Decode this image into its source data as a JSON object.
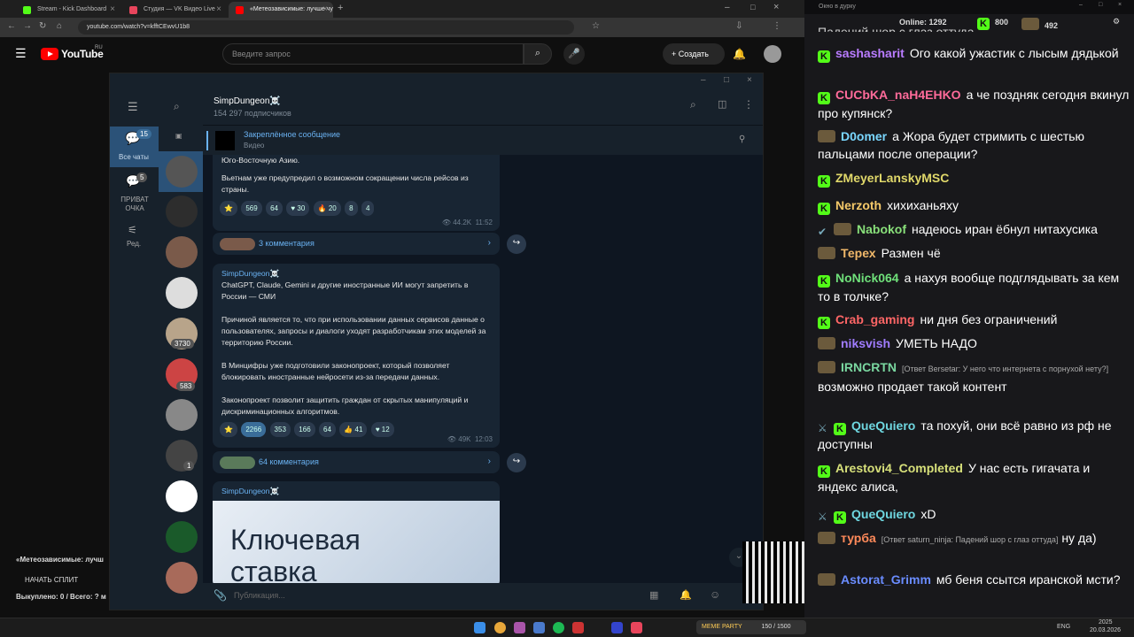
{
  "browser": {
    "tabs": [
      {
        "label": "Stream - Kick Dashboard",
        "color": "#53fc18"
      },
      {
        "label": "Студия — VK Видео Live",
        "color": "#e8455c"
      },
      {
        "label": "«Метеозависимые: лучше чу",
        "color": "#ff0000"
      }
    ],
    "url": "youtube.com/watch?v=kfftCEwvU1b8"
  },
  "youtube": {
    "logo_text": "YouTube",
    "region": "RU",
    "search_placeholder": "Введите запрос",
    "create_label": "Создать",
    "left_text_1": "«Метеозависимые: лучш",
    "left_text_2": "НАЧАТЬ СПЛИТ",
    "left_text_3": "Выкуплено: 0 / Всего: ? м"
  },
  "telegram": {
    "sidebar": {
      "all_chats_label": "Все чаты",
      "all_chats_badge": "15",
      "private_label": "ПРИВАТ ОЧКА",
      "private_badge": "5",
      "edit_label": "Ред."
    },
    "list_badges": [
      "3730",
      "583",
      "1"
    ],
    "channel": {
      "name": "SimpDungeon☠️",
      "subs": "154 297 подписчиков"
    },
    "pinned": {
      "title": "Закреплённое сообщение",
      "subtitle": "Видео"
    },
    "msg1": {
      "text_a": "Юго-Восточную Азию.",
      "text_b": "Вьетнам уже предупредил о возможном сокращении числа рейсов из страны.",
      "reactions": [
        "⭐",
        "569",
        "64",
        "♥ 30",
        "🔥 20",
        "8",
        "4"
      ],
      "views": "44.2K",
      "time": "11:52",
      "comments": "3 комментария"
    },
    "msg2": {
      "author": "SimpDungeon☠️",
      "p1": "ChatGPT, Claude, Gemini и другие иностранные ИИ могут запретить в России — СМИ",
      "p2": "Причиной является то, что при использовании данных сервисов данные о пользователях, запросы и диалоги уходят разработчикам этих моделей за территорию России.",
      "p3": "В Минцифры уже подготовили законопроект, который позволяет блокировать иностранные нейросети из-за передачи данных.",
      "p4": "Законопроект позволит защитить граждан от скрытых манипуляций и дискриминационных алгоритмов.",
      "reactions": [
        "⭐",
        "2266",
        "353",
        "166",
        "64",
        "👍 41",
        "♥ 12"
      ],
      "views": "49K",
      "time": "12:03",
      "comments": "64 комментария"
    },
    "msg3": {
      "author": "SimpDungeon☠️",
      "image_text": "Ключевая ставка"
    },
    "composer_placeholder": "Публикация..."
  },
  "stream": {
    "window_title": "Окно в дурку",
    "online_label": "Online:",
    "online": "1292",
    "kick_count": "800",
    "other_count": "492",
    "top_cut": "Падений шор с глаз оттуда",
    "messages": [
      {
        "user": "sashasharit",
        "color": "#b97cff",
        "badge": "k",
        "text": "Ого какой ужастик с лысым дядькой"
      },
      {
        "user": "CUCbKA_naH4EHKO",
        "color": "#ff6b9a",
        "badge": "k",
        "text": "а че поздняк сегодня вкинул про купянск?"
      },
      {
        "user": "D0omer",
        "color": "#7ad7ff",
        "badge": "s",
        "text": "а Жора будет стримить с шестью пальцами после операции?"
      },
      {
        "user": "ZMeyerLanskyMSC",
        "color": "#e0d86a",
        "badge": "k",
        "text": ""
      },
      {
        "user": "Nerzoth",
        "color": "#f5c969",
        "badge": "k",
        "text": "хихиханьяху"
      },
      {
        "user": "Nabokof",
        "color": "#89e07a",
        "badge": "vs",
        "text": "надеюсь иран ёбнул нитахусика"
      },
      {
        "user": "Терех",
        "color": "#f0b86a",
        "badge": "s",
        "text": "Размен чё"
      },
      {
        "user": "NoNick064",
        "color": "#6fe07a",
        "badge": "k",
        "text": "а нахуя вообще подглядывать за кем то в толчке?"
      },
      {
        "user": "Crab_gaming",
        "color": "#ff6666",
        "badge": "k",
        "text": "ни дня без ограничений"
      },
      {
        "user": "niksvish",
        "color": "#a07cff",
        "badge": "s",
        "text": "УМЕТЬ НАДО"
      },
      {
        "user": "IRNCRTN",
        "color": "#7ad7a0",
        "badge": "s",
        "reply": "[Ответ Bersetar: У него что интернета с порнухой нету?]",
        "text": "возможно продает такой контент"
      },
      {
        "user": "QueQuiero",
        "color": "#6fd7e0",
        "badge": "xk",
        "text": "та похуй, они всё равно из рф не доступны"
      },
      {
        "user": "Arestovi4_Completed",
        "color": "#d7e07a",
        "badge": "k",
        "text": "У нас есть гигачата и яндекс алиса,"
      },
      {
        "user": "QueQuiero",
        "color": "#6fd7e0",
        "badge": "xk",
        "text": "xD"
      },
      {
        "user": "турба",
        "color": "#ff8a5a",
        "badge": "s",
        "reply": "[Ответ saturn_ninja: Падений шор с глаз оттуда]",
        "text": "ну да)"
      },
      {
        "user": "Astorat_Grimm",
        "color": "#6a8cff",
        "badge": "s",
        "text": "мб беня ссытся иранской мсти?"
      }
    ]
  },
  "taskbar": {
    "lang": "ENG",
    "time": "2025",
    "date": "20.03.2026",
    "sidebar_widget": "MEME PARTY",
    "widget_count": "150 / 1500"
  }
}
